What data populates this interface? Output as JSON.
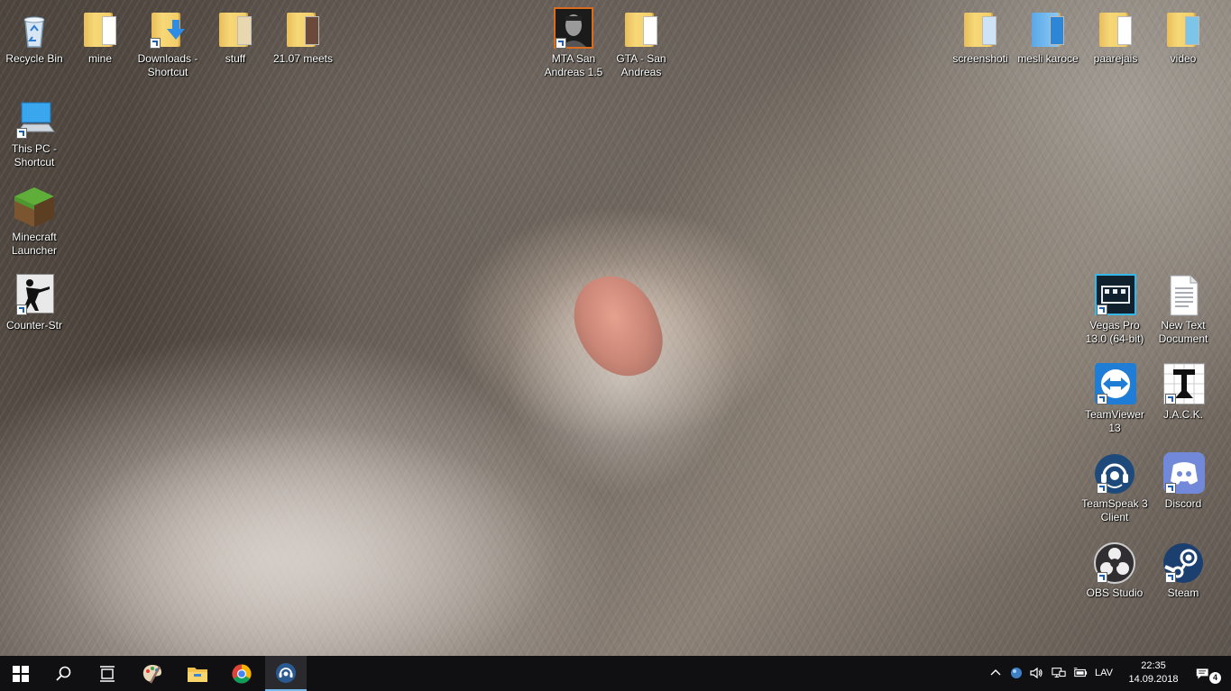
{
  "desktop_icons": {
    "recycle_bin": "Recycle Bin",
    "mine": "mine",
    "downloads": "Downloads - Shortcut",
    "stuff": "stuff",
    "meets": "21.07 meets",
    "mta": "MTA San Andreas 1.5",
    "gta": "GTA - San Andreas",
    "screenshoti": "screenshoti",
    "mesli_karoce": "mesli karoce",
    "paarejais": "paarejais",
    "video": "video",
    "this_pc": "This PC - Shortcut",
    "minecraft": "Minecraft Launcher",
    "counter_strike": "Counter-Str",
    "vegas_pro": "Vegas Pro 13.0 (64-bit)",
    "new_text_document": "New Text Document",
    "teamviewer": "TeamViewer 13",
    "jack": "J.A.C.K.",
    "teamspeak": "TeamSpeak 3 Client",
    "discord": "Discord",
    "obs": "OBS Studio",
    "steam": "Steam"
  },
  "taskbar": {
    "language": "LAV",
    "time": "22:35",
    "date": "14.09.2018",
    "notification_count": "4"
  },
  "colors": {
    "taskbar": "#101012",
    "accent": "#76b9ed",
    "folder": "#f2cd68"
  }
}
